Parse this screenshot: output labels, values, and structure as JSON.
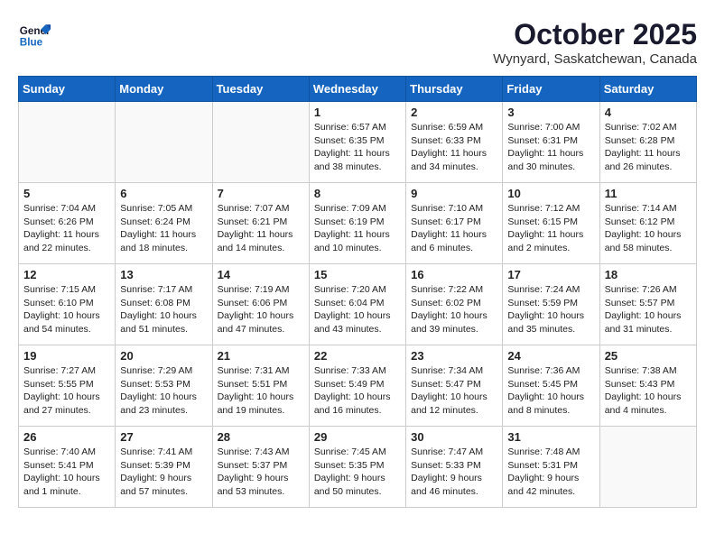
{
  "logo": {
    "line1": "General",
    "line2": "Blue"
  },
  "title": "October 2025",
  "subtitle": "Wynyard, Saskatchewan, Canada",
  "weekdays": [
    "Sunday",
    "Monday",
    "Tuesday",
    "Wednesday",
    "Thursday",
    "Friday",
    "Saturday"
  ],
  "weeks": [
    [
      {
        "day": "",
        "sunrise": "",
        "sunset": "",
        "daylight": ""
      },
      {
        "day": "",
        "sunrise": "",
        "sunset": "",
        "daylight": ""
      },
      {
        "day": "",
        "sunrise": "",
        "sunset": "",
        "daylight": ""
      },
      {
        "day": "1",
        "sunrise": "Sunrise: 6:57 AM",
        "sunset": "Sunset: 6:35 PM",
        "daylight": "Daylight: 11 hours and 38 minutes."
      },
      {
        "day": "2",
        "sunrise": "Sunrise: 6:59 AM",
        "sunset": "Sunset: 6:33 PM",
        "daylight": "Daylight: 11 hours and 34 minutes."
      },
      {
        "day": "3",
        "sunrise": "Sunrise: 7:00 AM",
        "sunset": "Sunset: 6:31 PM",
        "daylight": "Daylight: 11 hours and 30 minutes."
      },
      {
        "day": "4",
        "sunrise": "Sunrise: 7:02 AM",
        "sunset": "Sunset: 6:28 PM",
        "daylight": "Daylight: 11 hours and 26 minutes."
      }
    ],
    [
      {
        "day": "5",
        "sunrise": "Sunrise: 7:04 AM",
        "sunset": "Sunset: 6:26 PM",
        "daylight": "Daylight: 11 hours and 22 minutes."
      },
      {
        "day": "6",
        "sunrise": "Sunrise: 7:05 AM",
        "sunset": "Sunset: 6:24 PM",
        "daylight": "Daylight: 11 hours and 18 minutes."
      },
      {
        "day": "7",
        "sunrise": "Sunrise: 7:07 AM",
        "sunset": "Sunset: 6:21 PM",
        "daylight": "Daylight: 11 hours and 14 minutes."
      },
      {
        "day": "8",
        "sunrise": "Sunrise: 7:09 AM",
        "sunset": "Sunset: 6:19 PM",
        "daylight": "Daylight: 11 hours and 10 minutes."
      },
      {
        "day": "9",
        "sunrise": "Sunrise: 7:10 AM",
        "sunset": "Sunset: 6:17 PM",
        "daylight": "Daylight: 11 hours and 6 minutes."
      },
      {
        "day": "10",
        "sunrise": "Sunrise: 7:12 AM",
        "sunset": "Sunset: 6:15 PM",
        "daylight": "Daylight: 11 hours and 2 minutes."
      },
      {
        "day": "11",
        "sunrise": "Sunrise: 7:14 AM",
        "sunset": "Sunset: 6:12 PM",
        "daylight": "Daylight: 10 hours and 58 minutes."
      }
    ],
    [
      {
        "day": "12",
        "sunrise": "Sunrise: 7:15 AM",
        "sunset": "Sunset: 6:10 PM",
        "daylight": "Daylight: 10 hours and 54 minutes."
      },
      {
        "day": "13",
        "sunrise": "Sunrise: 7:17 AM",
        "sunset": "Sunset: 6:08 PM",
        "daylight": "Daylight: 10 hours and 51 minutes."
      },
      {
        "day": "14",
        "sunrise": "Sunrise: 7:19 AM",
        "sunset": "Sunset: 6:06 PM",
        "daylight": "Daylight: 10 hours and 47 minutes."
      },
      {
        "day": "15",
        "sunrise": "Sunrise: 7:20 AM",
        "sunset": "Sunset: 6:04 PM",
        "daylight": "Daylight: 10 hours and 43 minutes."
      },
      {
        "day": "16",
        "sunrise": "Sunrise: 7:22 AM",
        "sunset": "Sunset: 6:02 PM",
        "daylight": "Daylight: 10 hours and 39 minutes."
      },
      {
        "day": "17",
        "sunrise": "Sunrise: 7:24 AM",
        "sunset": "Sunset: 5:59 PM",
        "daylight": "Daylight: 10 hours and 35 minutes."
      },
      {
        "day": "18",
        "sunrise": "Sunrise: 7:26 AM",
        "sunset": "Sunset: 5:57 PM",
        "daylight": "Daylight: 10 hours and 31 minutes."
      }
    ],
    [
      {
        "day": "19",
        "sunrise": "Sunrise: 7:27 AM",
        "sunset": "Sunset: 5:55 PM",
        "daylight": "Daylight: 10 hours and 27 minutes."
      },
      {
        "day": "20",
        "sunrise": "Sunrise: 7:29 AM",
        "sunset": "Sunset: 5:53 PM",
        "daylight": "Daylight: 10 hours and 23 minutes."
      },
      {
        "day": "21",
        "sunrise": "Sunrise: 7:31 AM",
        "sunset": "Sunset: 5:51 PM",
        "daylight": "Daylight: 10 hours and 19 minutes."
      },
      {
        "day": "22",
        "sunrise": "Sunrise: 7:33 AM",
        "sunset": "Sunset: 5:49 PM",
        "daylight": "Daylight: 10 hours and 16 minutes."
      },
      {
        "day": "23",
        "sunrise": "Sunrise: 7:34 AM",
        "sunset": "Sunset: 5:47 PM",
        "daylight": "Daylight: 10 hours and 12 minutes."
      },
      {
        "day": "24",
        "sunrise": "Sunrise: 7:36 AM",
        "sunset": "Sunset: 5:45 PM",
        "daylight": "Daylight: 10 hours and 8 minutes."
      },
      {
        "day": "25",
        "sunrise": "Sunrise: 7:38 AM",
        "sunset": "Sunset: 5:43 PM",
        "daylight": "Daylight: 10 hours and 4 minutes."
      }
    ],
    [
      {
        "day": "26",
        "sunrise": "Sunrise: 7:40 AM",
        "sunset": "Sunset: 5:41 PM",
        "daylight": "Daylight: 10 hours and 1 minute."
      },
      {
        "day": "27",
        "sunrise": "Sunrise: 7:41 AM",
        "sunset": "Sunset: 5:39 PM",
        "daylight": "Daylight: 9 hours and 57 minutes."
      },
      {
        "day": "28",
        "sunrise": "Sunrise: 7:43 AM",
        "sunset": "Sunset: 5:37 PM",
        "daylight": "Daylight: 9 hours and 53 minutes."
      },
      {
        "day": "29",
        "sunrise": "Sunrise: 7:45 AM",
        "sunset": "Sunset: 5:35 PM",
        "daylight": "Daylight: 9 hours and 50 minutes."
      },
      {
        "day": "30",
        "sunrise": "Sunrise: 7:47 AM",
        "sunset": "Sunset: 5:33 PM",
        "daylight": "Daylight: 9 hours and 46 minutes."
      },
      {
        "day": "31",
        "sunrise": "Sunrise: 7:48 AM",
        "sunset": "Sunset: 5:31 PM",
        "daylight": "Daylight: 9 hours and 42 minutes."
      },
      {
        "day": "",
        "sunrise": "",
        "sunset": "",
        "daylight": ""
      }
    ]
  ]
}
